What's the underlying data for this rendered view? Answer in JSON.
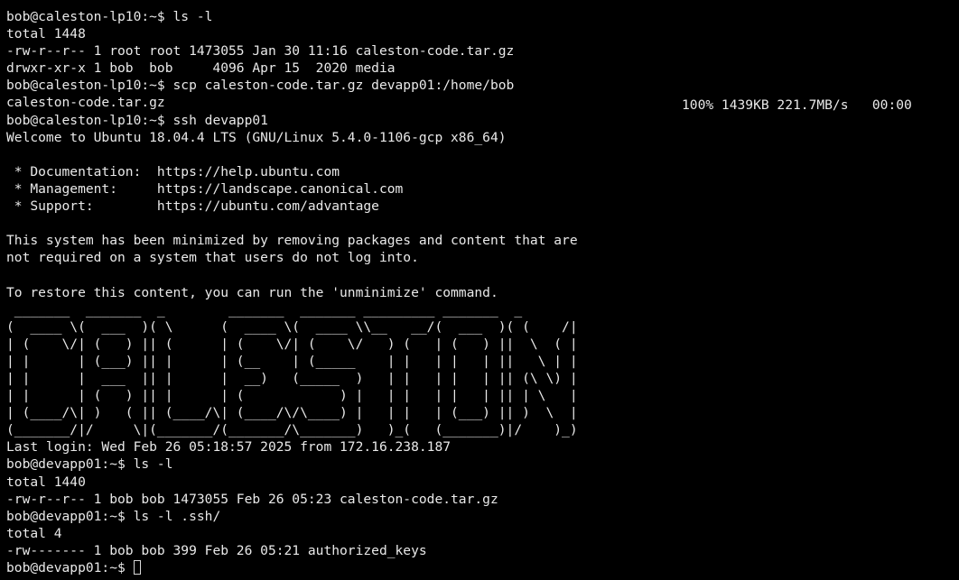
{
  "terminal": {
    "lines": [
      "bob@caleston-lp10:~$ ls -l",
      "total 1448",
      "-rw-r--r-- 1 root root 1473055 Jan 30 11:16 caleston-code.tar.gz",
      "drwxr-xr-x 1 bob  bob     4096 Apr 15  2020 media",
      "bob@caleston-lp10:~$ scp caleston-code.tar.gz devapp01:/home/bob",
      "caleston-code.tar.gz",
      "bob@caleston-lp10:~$ ssh devapp01",
      "Welcome to Ubuntu 18.04.4 LTS (GNU/Linux 5.4.0-1106-gcp x86_64)",
      "",
      " * Documentation:  https://help.ubuntu.com",
      " * Management:     https://landscape.canonical.com",
      " * Support:        https://ubuntu.com/advantage",
      "",
      "This system has been minimized by removing packages and content that are",
      "not required on a system that users do not log into.",
      "",
      "To restore this content, you can run the 'unminimize' command.",
      " _______  _______  _        _______  _______ _________ _______  _",
      "(  ____ \\(  ___  )( \\      (  ____ \\(  ____ \\\\__   __/(  ___  )( (    /|",
      "| (    \\/| (   ) || (      | (    \\/| (    \\/   ) (   | (   ) ||  \\  ( |",
      "| |      | (___) || |      | (__    | (_____    | |   | |   | ||   \\ | |",
      "| |      |  ___  || |      |  __)   (_____  )   | |   | |   | || (\\ \\) |",
      "| |      | (   ) || |      | (            ) |   | |   | |   | || | \\   |",
      "| (____/\\| )   ( || (____/\\| (____/\\/\\____) |   | |   | (___) || )  \\  |",
      "(_______/|/     \\|(_______/(_______/\\_______)   )_(   (_______)|/    )_)",
      "Last login: Wed Feb 26 05:18:57 2025 from 172.16.238.187",
      "bob@devapp01:~$ ls -l",
      "total 1440",
      "-rw-r--r-- 1 bob bob 1473055 Feb 26 05:23 caleston-code.tar.gz",
      "bob@devapp01:~$ ls -l .ssh/",
      "total 4",
      "-rw------- 1 bob bob 399 Feb 26 05:21 authorized_keys",
      "bob@devapp01:~$ "
    ],
    "scp_progress": "100% 1439KB 221.7MB/s   00:00"
  },
  "colors": {
    "background": "#000000",
    "foreground": "#e9e9e9"
  },
  "icons": {
    "cursor": "block-cursor-outline"
  }
}
